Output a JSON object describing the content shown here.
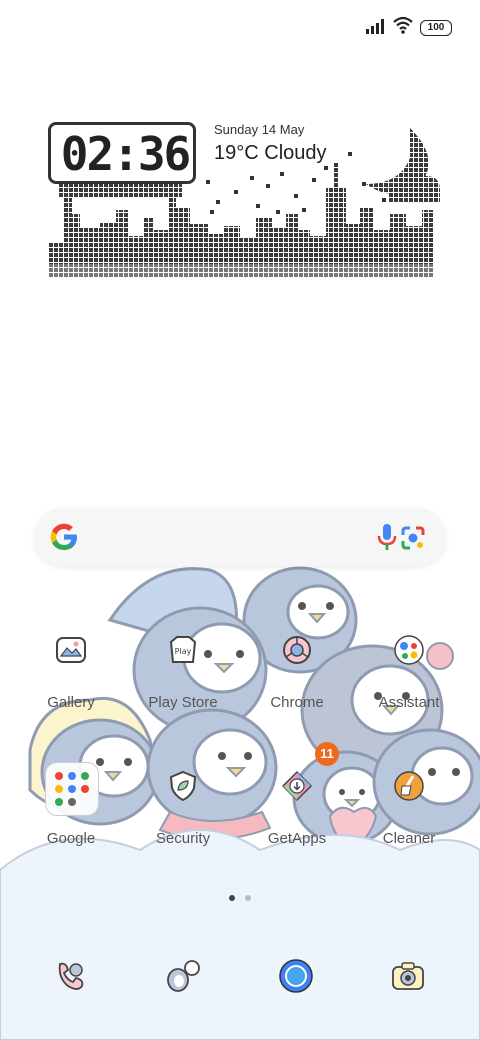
{
  "status_bar": {
    "battery": "100"
  },
  "widget": {
    "time": "02:36",
    "date": "Sunday 14 May",
    "weather": "19°C  Cloudy"
  },
  "search": {
    "google_icon": "google-g-icon",
    "voice_icon": "mic-icon",
    "lens_icon": "lens-icon"
  },
  "apps": [
    {
      "label": "Gallery",
      "icon": "gallery-icon"
    },
    {
      "label": "Play Store",
      "icon": "play-store-icon"
    },
    {
      "label": "Chrome",
      "icon": "chrome-icon"
    },
    {
      "label": "Assistant",
      "icon": "assistant-icon"
    },
    {
      "label": "Google",
      "icon": "folder-icon"
    },
    {
      "label": "Security",
      "icon": "security-icon"
    },
    {
      "label": "GetApps",
      "icon": "getapps-icon",
      "badge": "11"
    },
    {
      "label": "Cleaner",
      "icon": "cleaner-icon"
    }
  ],
  "page_indicator": {
    "pages": 2,
    "current": 1
  },
  "dock": [
    {
      "icon": "phone-icon"
    },
    {
      "icon": "messages-icon"
    },
    {
      "icon": "browser-icon"
    },
    {
      "icon": "camera-icon"
    }
  ],
  "colors": {
    "badge": "#f06a1e",
    "wallpaper_penguin": "#b9c7dc",
    "cloud": "#eef4fc"
  }
}
